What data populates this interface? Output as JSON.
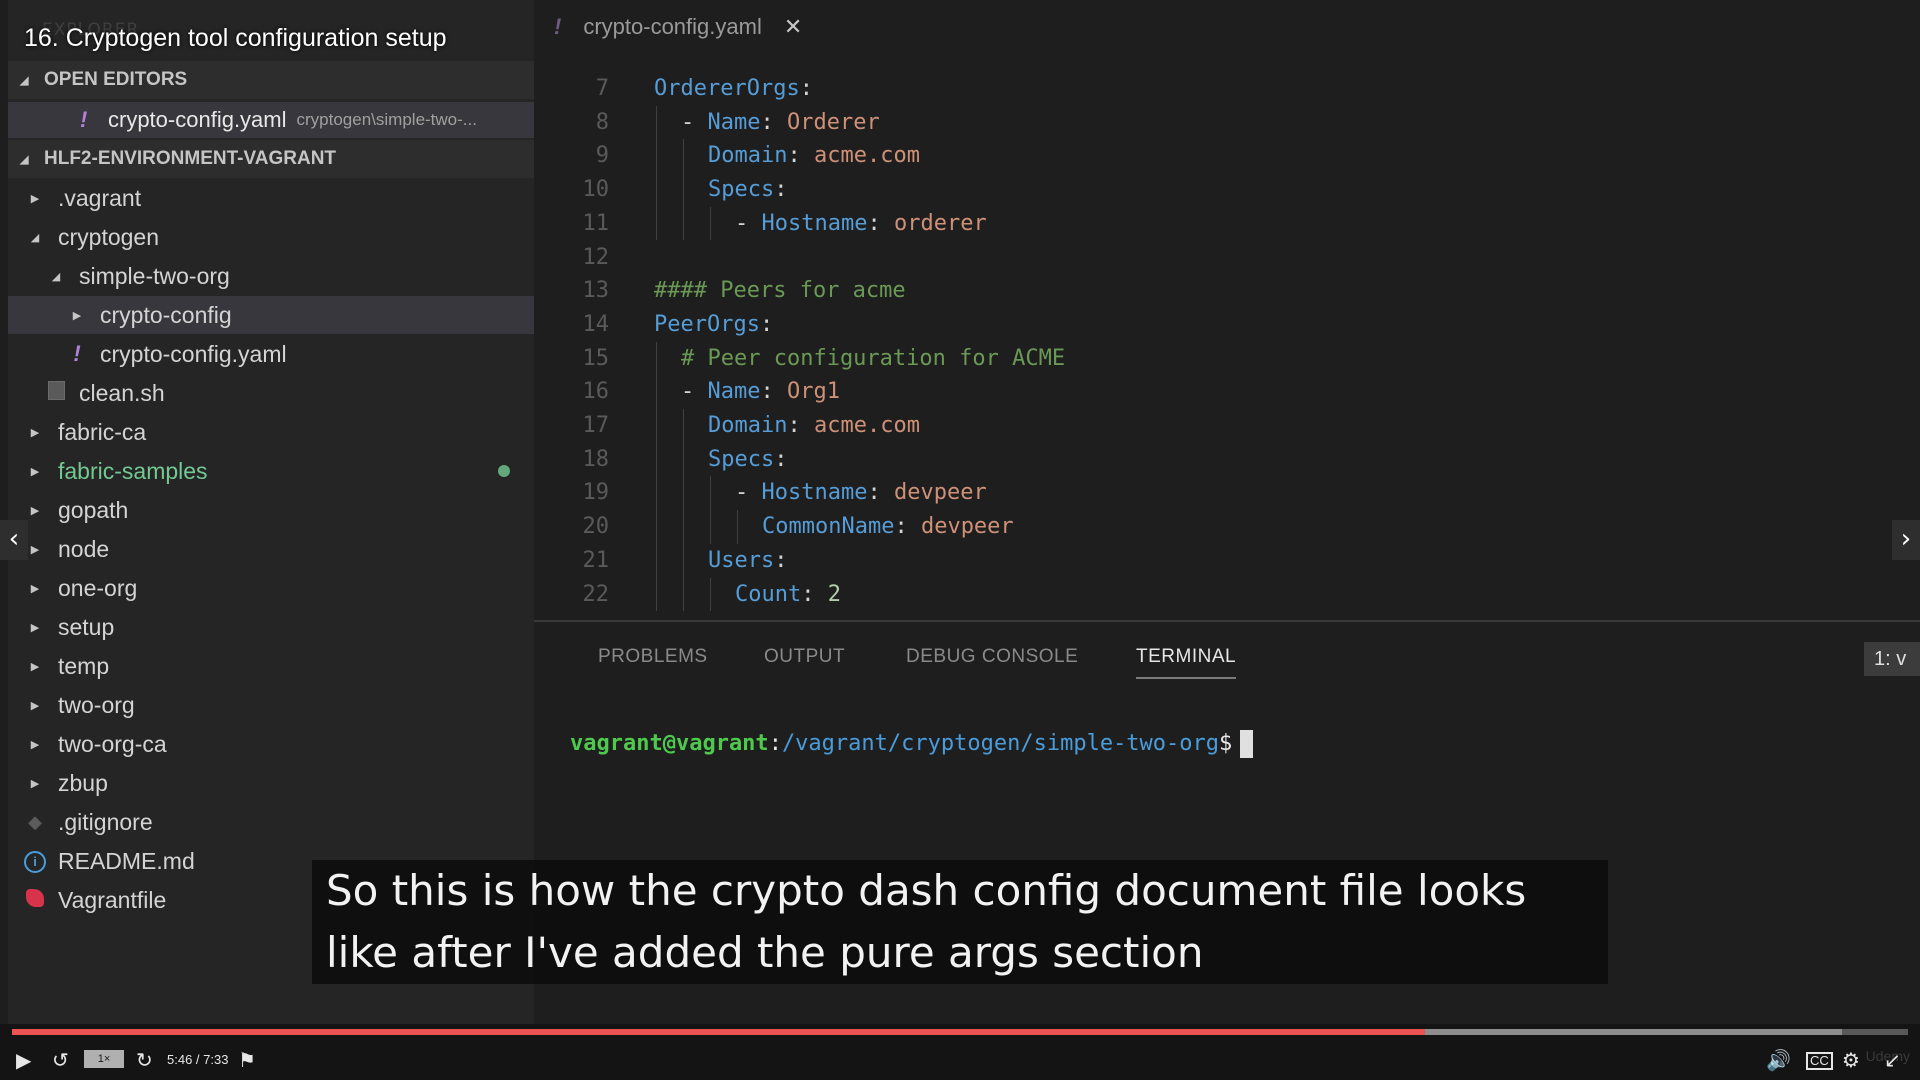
{
  "video": {
    "title": "16. Cryptogen tool configuration setup",
    "caption_line1": "So this is how the crypto dash config document file looks",
    "caption_line2": "like after I've added the pure args section",
    "progress_fraction": 0.745,
    "buffered_fraction": 0.965,
    "speed_label": "1×",
    "time_label": "5:46 / 7:33",
    "brand_label": "Udemy",
    "term_select_label": "1: v"
  },
  "explorer": {
    "ghost_title": "EXPLORER",
    "open_editors_label": "OPEN EDITORS",
    "open_editor": {
      "name": "crypto-config.yaml",
      "path": "cryptogen\\simple-two-..."
    },
    "workspace_label": "HLF2-ENVIRONMENT-VAGRANT",
    "tree": [
      {
        "label": ".vagrant",
        "depth": 1,
        "kind": "folder",
        "expanded": false
      },
      {
        "label": "cryptogen",
        "depth": 1,
        "kind": "folder",
        "expanded": true
      },
      {
        "label": "simple-two-org",
        "depth": 2,
        "kind": "folder",
        "expanded": true
      },
      {
        "label": "crypto-config",
        "depth": 3,
        "kind": "folder",
        "expanded": false,
        "selected": true
      },
      {
        "label": "crypto-config.yaml",
        "depth": 3,
        "kind": "file",
        "icon": "yaml-icon"
      },
      {
        "label": "clean.sh",
        "depth": 2,
        "kind": "file",
        "icon": "shell-icon"
      },
      {
        "label": "fabric-ca",
        "depth": 1,
        "kind": "folder",
        "expanded": false
      },
      {
        "label": "fabric-samples",
        "depth": 1,
        "kind": "folder",
        "expanded": false,
        "modified": true
      },
      {
        "label": "gopath",
        "depth": 1,
        "kind": "folder",
        "expanded": false
      },
      {
        "label": "node",
        "depth": 1,
        "kind": "folder",
        "expanded": false
      },
      {
        "label": "one-org",
        "depth": 1,
        "kind": "folder",
        "expanded": false
      },
      {
        "label": "setup",
        "depth": 1,
        "kind": "folder",
        "expanded": false
      },
      {
        "label": "temp",
        "depth": 1,
        "kind": "folder",
        "expanded": false
      },
      {
        "label": "two-org",
        "depth": 1,
        "kind": "folder",
        "expanded": false
      },
      {
        "label": "two-org-ca",
        "depth": 1,
        "kind": "folder",
        "expanded": false
      },
      {
        "label": "zbup",
        "depth": 1,
        "kind": "folder",
        "expanded": false
      },
      {
        "label": ".gitignore",
        "depth": 1,
        "kind": "file",
        "icon": "git-icon"
      },
      {
        "label": "README.md",
        "depth": 1,
        "kind": "file",
        "icon": "info-icon"
      },
      {
        "label": "Vagrantfile",
        "depth": 1,
        "kind": "file",
        "icon": "vagrant-icon"
      }
    ]
  },
  "editor": {
    "tab_label": "crypto-config.yaml",
    "lines": [
      {
        "num": "7",
        "indent": 0,
        "tokens": [
          {
            "t": "OrdererOrgs",
            "c": "k"
          },
          {
            "t": ":",
            "c": "p"
          }
        ]
      },
      {
        "num": "8",
        "indent": 1,
        "tokens": [
          {
            "t": "- ",
            "c": "p"
          },
          {
            "t": "Name",
            "c": "k"
          },
          {
            "t": ": ",
            "c": "p"
          },
          {
            "t": "Orderer",
            "c": "s"
          }
        ]
      },
      {
        "num": "9",
        "indent": 2,
        "tokens": [
          {
            "t": "Domain",
            "c": "k"
          },
          {
            "t": ": ",
            "c": "p"
          },
          {
            "t": "acme.com",
            "c": "s"
          }
        ]
      },
      {
        "num": "10",
        "indent": 2,
        "tokens": [
          {
            "t": "Specs",
            "c": "k"
          },
          {
            "t": ":",
            "c": "p"
          }
        ]
      },
      {
        "num": "11",
        "indent": 3,
        "tokens": [
          {
            "t": "- ",
            "c": "p"
          },
          {
            "t": "Hostname",
            "c": "k"
          },
          {
            "t": ": ",
            "c": "p"
          },
          {
            "t": "orderer",
            "c": "s"
          }
        ]
      },
      {
        "num": "12",
        "indent": 0,
        "tokens": []
      },
      {
        "num": "13",
        "indent": 0,
        "tokens": [
          {
            "t": "#### Peers for acme",
            "c": "c"
          }
        ]
      },
      {
        "num": "14",
        "indent": 0,
        "tokens": [
          {
            "t": "PeerOrgs",
            "c": "k"
          },
          {
            "t": ":",
            "c": "p"
          }
        ]
      },
      {
        "num": "15",
        "indent": 1,
        "tokens": [
          {
            "t": "# Peer configuration for ACME",
            "c": "c"
          }
        ]
      },
      {
        "num": "16",
        "indent": 1,
        "tokens": [
          {
            "t": "- ",
            "c": "p"
          },
          {
            "t": "Name",
            "c": "k"
          },
          {
            "t": ": ",
            "c": "p"
          },
          {
            "t": "Org1",
            "c": "s"
          }
        ]
      },
      {
        "num": "17",
        "indent": 2,
        "tokens": [
          {
            "t": "Domain",
            "c": "k"
          },
          {
            "t": ": ",
            "c": "p"
          },
          {
            "t": "acme.com",
            "c": "s"
          }
        ]
      },
      {
        "num": "18",
        "indent": 2,
        "tokens": [
          {
            "t": "Specs",
            "c": "k"
          },
          {
            "t": ":",
            "c": "p"
          }
        ]
      },
      {
        "num": "19",
        "indent": 3,
        "tokens": [
          {
            "t": "- ",
            "c": "p"
          },
          {
            "t": "Hostname",
            "c": "k"
          },
          {
            "t": ": ",
            "c": "p"
          },
          {
            "t": "devpeer",
            "c": "s"
          }
        ]
      },
      {
        "num": "20",
        "indent": 4,
        "tokens": [
          {
            "t": "CommonName",
            "c": "k"
          },
          {
            "t": ": ",
            "c": "p"
          },
          {
            "t": "devpeer",
            "c": "s"
          }
        ]
      },
      {
        "num": "21",
        "indent": 2,
        "tokens": [
          {
            "t": "Users",
            "c": "k"
          },
          {
            "t": ":",
            "c": "p"
          }
        ]
      },
      {
        "num": "22",
        "indent": 3,
        "tokens": [
          {
            "t": "Count",
            "c": "k"
          },
          {
            "t": ": ",
            "c": "p"
          },
          {
            "t": "2",
            "c": "n"
          }
        ]
      }
    ]
  },
  "panel": {
    "tabs": [
      {
        "label": "PROBLEMS",
        "active": false
      },
      {
        "label": "OUTPUT",
        "active": false
      },
      {
        "label": "DEBUG CONSOLE",
        "active": false
      },
      {
        "label": "TERMINAL",
        "active": true
      }
    ],
    "terminal": {
      "user": "vagrant@vagrant",
      "sep": ":",
      "path": "/vagrant/cryptogen/simple-two-org",
      "prompt": "$"
    }
  },
  "colors": {
    "accent_progress": "#ec5252",
    "yaml_key": "#569cd6",
    "yaml_string": "#ce9178",
    "yaml_comment": "#6a9955",
    "terminal_user": "#4ec94e",
    "terminal_path": "#4a9cdb"
  }
}
